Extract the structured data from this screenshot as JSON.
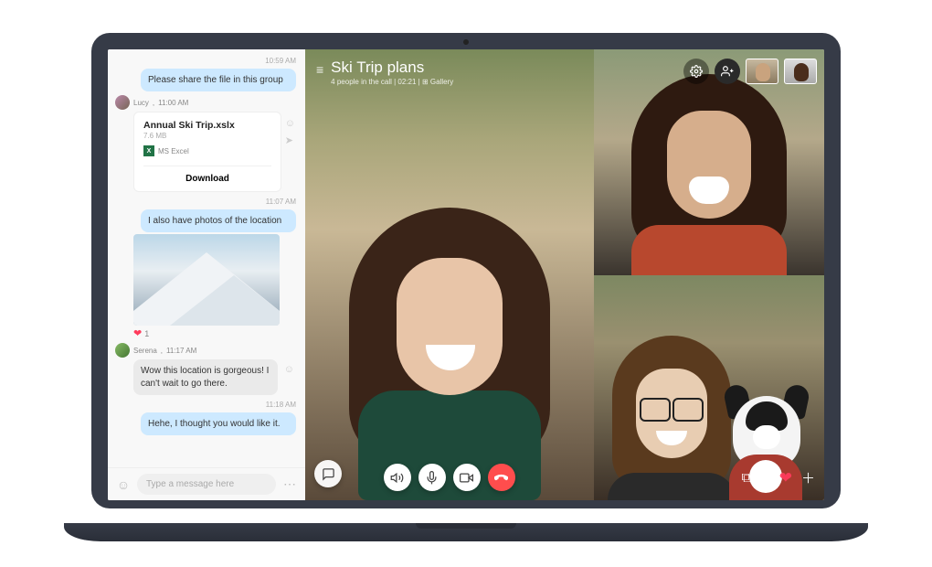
{
  "chat": {
    "ts0": "10:59 AM",
    "bubble0": "Please share the file in this group",
    "sender1_name": "Lucy",
    "sender1_time": "11:00 AM",
    "file": {
      "name": "Annual Ski Trip.xslx",
      "size": "7.6 MB",
      "app": "MS Excel",
      "download": "Download"
    },
    "ts1": "11:07 AM",
    "bubble1": "I also have photos of the location",
    "reaction_count": "1",
    "sender2_name": "Serena",
    "sender2_time": "11:17 AM",
    "bubble_in": "Wow this location is gorgeous! I can't wait to go there.",
    "ts2": "11:18 AM",
    "bubble2": "Hehe, I thought you would like it.",
    "composer_placeholder": "Type a message here"
  },
  "call": {
    "title": "Ski Trip plans",
    "subtitle": "4 people in the call | 02:21 | ⊞ Gallery"
  }
}
